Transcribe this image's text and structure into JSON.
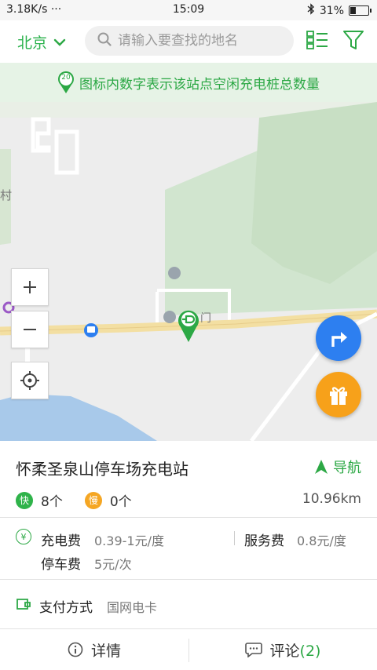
{
  "status_bar": {
    "network_speed": "3.18K/s ···",
    "time": "15:09",
    "battery": "31%",
    "battery_level": 0.31
  },
  "header": {
    "city": "北京",
    "search_placeholder": "请输入要查找的地名"
  },
  "notice": {
    "badge": "20",
    "text": "图标内数字表示该站点空闲充电桩总数量"
  },
  "map": {
    "labels": {
      "place_char_1": "村",
      "place_char_2": "门"
    }
  },
  "station": {
    "name": "怀柔圣泉山停车场充电站",
    "nav_label": "导航",
    "fast_badge": "快",
    "fast_count": "8个",
    "slow_badge": "慢",
    "slow_count": "0个",
    "distance": "10.96km",
    "fee_icon": "¥",
    "charge_fee_label": "充电费",
    "charge_fee_value": "0.39-1元/度",
    "service_fee_label": "服务费",
    "service_fee_value": "0.8元/度",
    "parking_fee_label": "停车费",
    "parking_fee_value": "5元/次",
    "payment_label": "支付方式",
    "payment_value": "国网电卡"
  },
  "tabs": {
    "details_label": "详情",
    "comments_label": "评论",
    "comments_count": "(2)"
  },
  "colors": {
    "accent_green": "#2ca845",
    "fast_green": "#2fb34a",
    "slow_orange": "#f5a623",
    "route_blue": "#2d7ff0",
    "gift_orange": "#f7a11a"
  }
}
